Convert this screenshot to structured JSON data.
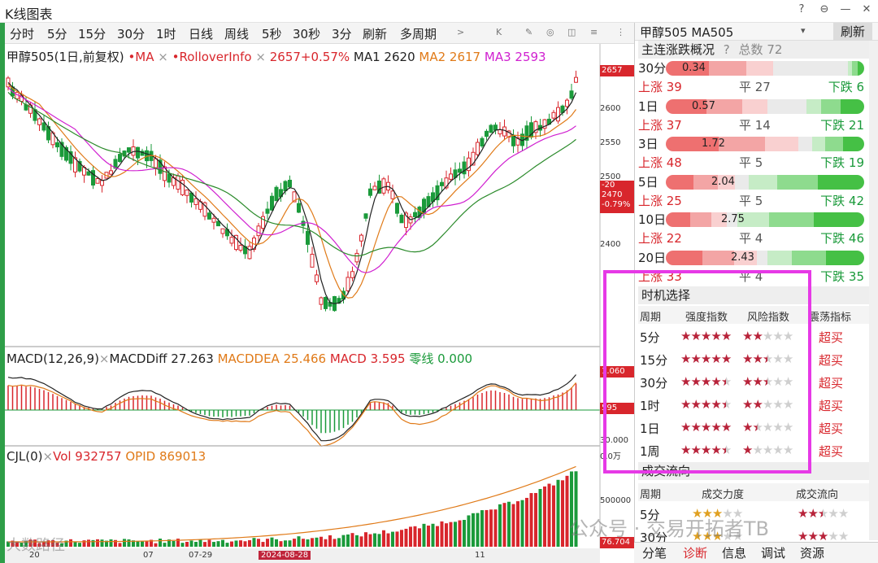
{
  "window": {
    "title": "K线图表",
    "controls": [
      "?",
      "⊖",
      "—",
      "✕"
    ]
  },
  "tabs": [
    "分时",
    "5分",
    "15分",
    "30分",
    "1时",
    "日线",
    "周线",
    "5秒",
    "30秒",
    "3分",
    "刷新",
    "多周期"
  ],
  "tools": [
    ">",
    "K",
    "✎",
    "◎",
    "◫",
    "≡",
    "⋮"
  ],
  "legend_main": {
    "instrument": "甲醇505(1日,前复权)",
    "ma": "•MA",
    "rollover": "•RolloverInfo",
    "price": "2657+0.57%",
    "ma1": "MA1 2620",
    "ma2": "MA2 2617",
    "ma3": "MA3 2593"
  },
  "legend_macd": {
    "name": "MACD(12,26,9)",
    "diff": "MACDDiff 27.263",
    "dea": "MACDDEA 25.466",
    "macd": "MACD 3.595",
    "zero": "零线 0.000"
  },
  "legend_vol": {
    "name": "CJL(0)",
    "vol": "Vol 932757",
    "opid": "OPID 869013"
  },
  "price_axis": [
    "2600",
    "2550",
    "2500",
    "2400"
  ],
  "price_tags": {
    "last": "2657",
    "change": "-20",
    "prev": "2470",
    "pct": "-0.79%"
  },
  "macd_axis": {
    "top": "1.060",
    "mid": "595",
    "low": "30.000",
    "unit": "0.0万"
  },
  "vol_axis": {
    "mid": "500000",
    "bottom": "76.704"
  },
  "dates": [
    "20",
    "07",
    "07-29",
    "2024-08-28",
    "11"
  ],
  "watermark_left": "大数路径",
  "watermark_right": "公众号 · 交易开拓者TB",
  "right_panel": {
    "instrument": "甲醇505  MA505",
    "dropdown": "▾",
    "refresh": "刷新",
    "overview_title": "主连涨跌概况",
    "overview_help": "?",
    "overview_total": "总数 72",
    "periods": [
      {
        "label": "30分",
        "value": "0.34",
        "up": "上涨 39",
        "flat": "平 27",
        "down": "下跌 6"
      },
      {
        "label": "1日",
        "value": "0.57",
        "up": "上涨 37",
        "flat": "平 14",
        "down": "下跌 21"
      },
      {
        "label": "3日",
        "value": "1.72",
        "up": "上涨 48",
        "flat": "平 5",
        "down": "下跌 19"
      },
      {
        "label": "5日",
        "value": "2.04",
        "up": "上涨 25",
        "flat": "平 5",
        "down": "下跌 42"
      },
      {
        "label": "10日",
        "value": "2.75",
        "up": "上涨 22",
        "flat": "平 4",
        "down": "下跌 46"
      },
      {
        "label": "20日",
        "value": "2.43",
        "up": "上涨 33",
        "flat": "平 4",
        "down": "下跌 35"
      }
    ],
    "timing_title": "时机选择",
    "timing_headers": [
      "周期",
      "强度指数",
      "风险指数",
      "震荡指标"
    ],
    "timing_rows": [
      {
        "period": "5分",
        "strength": 5,
        "risk": 2,
        "signal": "超买"
      },
      {
        "period": "15分",
        "strength": 5,
        "risk": 2.5,
        "signal": "超买"
      },
      {
        "period": "30分",
        "strength": 4.5,
        "risk": 2.5,
        "signal": "超买"
      },
      {
        "period": "1时",
        "strength": 4.5,
        "risk": 2,
        "signal": "超买"
      },
      {
        "period": "1日",
        "strength": 5,
        "risk": 1.5,
        "signal": "超买"
      },
      {
        "period": "1周",
        "strength": 4.5,
        "risk": 1,
        "signal": "超买"
      }
    ],
    "flow_title": "成交流向",
    "flow_headers": [
      "周期",
      "成交力度",
      "成交流向"
    ],
    "flow_rows": [
      {
        "period": "5分",
        "power": 3,
        "flow": 2.5
      },
      {
        "period": "30分",
        "power": 3,
        "flow": 3
      }
    ],
    "bottom_tabs": [
      "分笔",
      "诊断",
      "信息",
      "调试",
      "资源"
    ],
    "active_tab": "诊断"
  },
  "colors": {
    "up": "#d8262c",
    "down": "#1a9a3a",
    "ma1": "#222222",
    "ma2": "#e07a18",
    "ma3": "#d020d0",
    "ma4": "#2a8a2a",
    "highlight": "#e639e6"
  }
}
